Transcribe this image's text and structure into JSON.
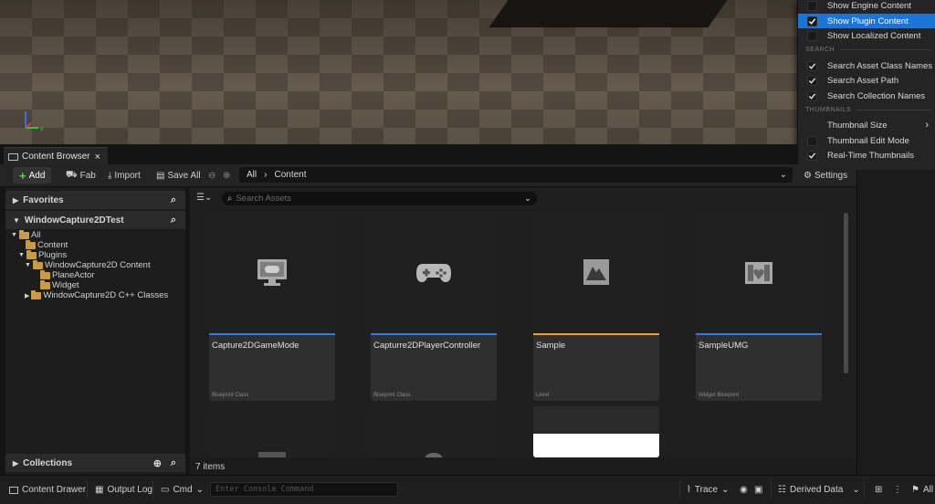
{
  "menu": {
    "items": [
      {
        "label": "Show Engine Content",
        "checked": false,
        "selected": false
      },
      {
        "label": "Show Plugin Content",
        "checked": true,
        "selected": true
      },
      {
        "label": "Show Localized Content",
        "checked": false,
        "selected": false
      }
    ],
    "search_section": "SEARCH",
    "search_items": [
      {
        "label": "Search Asset Class Names",
        "checked": true
      },
      {
        "label": "Search Asset Path",
        "checked": true
      },
      {
        "label": "Search Collection Names",
        "checked": true
      }
    ],
    "thumbnails_section": "THUMBNAILS",
    "thumbnail_items": [
      {
        "label": "Thumbnail Size",
        "submenu": true
      },
      {
        "label": "Thumbnail Edit Mode",
        "checked": false
      },
      {
        "label": "Real-Time Thumbnails",
        "checked": true
      }
    ]
  },
  "tab": {
    "label": "Content Browser",
    "close": "×"
  },
  "toolbar": {
    "add_label": "Add",
    "fab_label": "Fab",
    "import_label": "Import",
    "save_all_label": "Save All",
    "path": [
      "All",
      "Content"
    ],
    "settings_label": "Settings"
  },
  "sources": {
    "favorites_label": "Favorites",
    "project_label": "WindowCapture2DTest",
    "collections_label": "Collections",
    "tree": {
      "all": "All",
      "content": "Content",
      "plugins": "Plugins",
      "plugin_content": "WindowCapture2D Content",
      "plane_actor": "PlaneActor",
      "widget": "Widget",
      "cpp_classes": "WindowCapture2D C++ Classes"
    }
  },
  "assets": {
    "search_placeholder": "Search Assets",
    "items": [
      {
        "name": "Capture2DGameMode",
        "type": "Blueprint Class",
        "color": "#3d78d6",
        "icon": "monitor-gamepad-icon"
      },
      {
        "name": "Capturre2DPlayerController",
        "type": "Blueprint Class",
        "color": "#3d78d6",
        "icon": "gamepad-icon"
      },
      {
        "name": "Sample",
        "type": "Level",
        "color": "#e6a02a",
        "icon": "level-mountain-icon"
      },
      {
        "name": "SampleUMG",
        "type": "Widget Blueprint",
        "color": "#3d78d6",
        "icon": "widget-blueprint-icon"
      }
    ],
    "count_label": "7 items"
  },
  "bottom": {
    "content_drawer": "Content Drawer",
    "output_log": "Output Log",
    "cmd": "Cmd",
    "console_placeholder": "Enter Console Command",
    "trace": "Trace",
    "derived_data": "Derived Data",
    "all": "All"
  }
}
